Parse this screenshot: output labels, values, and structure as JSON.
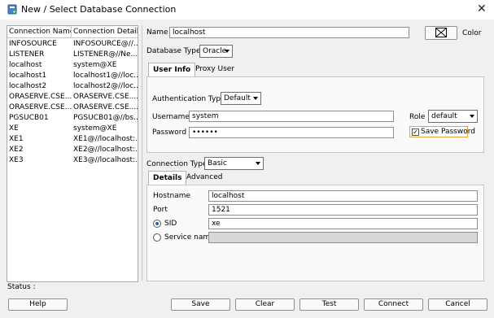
{
  "window": {
    "title": "New / Select Database Connection",
    "close": "✕"
  },
  "list": {
    "headers": [
      "Connection Name",
      "Connection Details"
    ],
    "rows": [
      [
        "INFOSOURCE",
        "INFOSOURCE@//..."
      ],
      [
        "LISTENER",
        "LISTENER@//Ne..."
      ],
      [
        "localhost",
        "system@XE"
      ],
      [
        "localhost1",
        "localhost1@//loc..."
      ],
      [
        "localhost2",
        "localhost2@//loc..."
      ],
      [
        "ORASERVE.CSE....",
        "ORASERVE.CSE...."
      ],
      [
        "ORASERVE.CSE....",
        "ORASERVE.CSE...."
      ],
      [
        "PGSUCB01",
        "PGSUCB01@//bs..."
      ],
      [
        "XE",
        "system@XE"
      ],
      [
        "XE1",
        "XE1@//localhost:..."
      ],
      [
        "XE2",
        "XE2@//localhost:..."
      ],
      [
        "XE3",
        "XE3@//localhost:..."
      ]
    ]
  },
  "form": {
    "name_label": "Name",
    "name_value": "localhost",
    "color_label": "Color",
    "db_type_label": "Database Type",
    "db_type_value": "Oracle",
    "tabs": [
      "User Info",
      "Proxy User"
    ],
    "auth_type_label": "Authentication Type",
    "auth_type_value": "Default",
    "username_label": "Username",
    "username_value": "system",
    "role_label": "Role",
    "role_value": "default",
    "password_label": "Password",
    "password_value": "••••••",
    "save_password_label": "Save Password",
    "save_password_checked": "✓",
    "conn_type_label": "Connection Type",
    "conn_type_value": "Basic",
    "detail_tabs": [
      "Details",
      "Advanced"
    ],
    "hostname_label": "Hostname",
    "hostname_value": "localhost",
    "port_label": "Port",
    "port_value": "1521",
    "sid_label": "SID",
    "sid_value": "xe",
    "service_label": "Service name",
    "service_value": ""
  },
  "status_label": "Status :",
  "buttons": {
    "help": "Help",
    "save": "Save",
    "clear": "Clear",
    "test": "Test",
    "connect": "Connect",
    "cancel": "Cancel"
  }
}
